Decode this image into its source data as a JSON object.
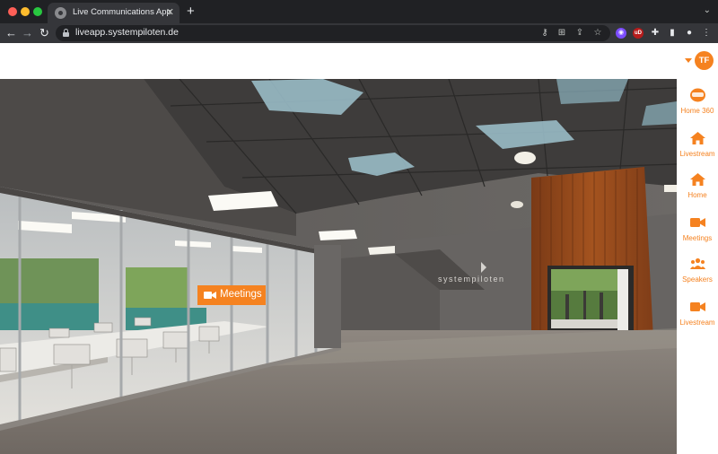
{
  "browser": {
    "tab_title": "Live Communications App",
    "tab_close": "✕",
    "new_tab": "+",
    "tab_menu": "⌄",
    "url": "liveapp.systempiloten.de",
    "ext_ublock": "uD"
  },
  "header": {
    "user_initials": "TF",
    "accent_color": "#f58220"
  },
  "scene": {
    "wall_logo": "systempiloten",
    "hotspot_label": "Meetings"
  },
  "sidenav": {
    "items": [
      {
        "label": "Home 360",
        "icon": "vr-headset-icon"
      },
      {
        "label": "Livestream",
        "icon": "home-icon"
      },
      {
        "label": "Home",
        "icon": "home-icon"
      },
      {
        "label": "Meetings",
        "icon": "video-camera-icon"
      },
      {
        "label": "Speakers",
        "icon": "group-icon"
      },
      {
        "label": "Livestream",
        "icon": "video-camera-icon"
      }
    ]
  }
}
